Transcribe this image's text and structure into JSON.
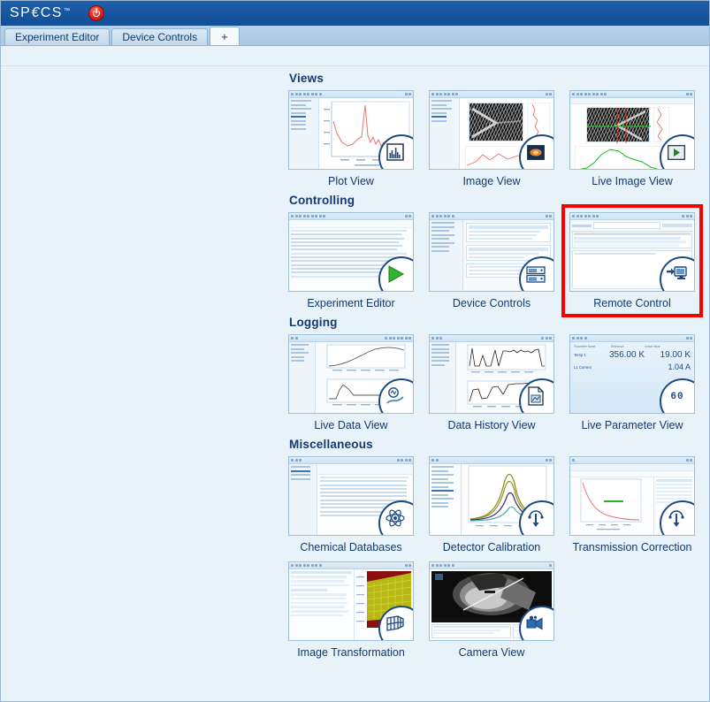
{
  "titlebar": {
    "brand": "SPECS",
    "trademark": "™",
    "power_icon": "power-icon"
  },
  "tabs": [
    {
      "label": "Experiment Editor",
      "active": false
    },
    {
      "label": "Device Controls",
      "active": false
    },
    {
      "label": "+",
      "active": true
    }
  ],
  "highlight": {
    "color": "#fc0000",
    "target": "Remote Control"
  },
  "sections": [
    {
      "title": "Views",
      "cards": [
        {
          "label": "Plot View",
          "icon": "plot-view-icon",
          "highlighted": false
        },
        {
          "label": "Image View",
          "icon": "image-view-icon",
          "highlighted": false
        },
        {
          "label": "Live Image View",
          "icon": "live-image-view-icon",
          "highlighted": false
        }
      ]
    },
    {
      "title": "Controlling",
      "cards": [
        {
          "label": "Experiment Editor",
          "icon": "play-icon",
          "highlighted": false
        },
        {
          "label": "Device Controls",
          "icon": "rack-icon",
          "highlighted": false
        },
        {
          "label": "Remote Control",
          "icon": "remote-control-icon",
          "highlighted": true
        }
      ]
    },
    {
      "title": "Logging",
      "cards": [
        {
          "label": "Live Data View",
          "icon": "live-data-icon",
          "highlighted": false
        },
        {
          "label": "Data History View",
          "icon": "document-chart-icon",
          "highlighted": false
        },
        {
          "label": "Live Parameter View",
          "icon": "sixty-icon",
          "highlighted": false
        }
      ]
    },
    {
      "title": "Miscellaneous",
      "cards": [
        {
          "label": "Chemical Databases",
          "icon": "atom-icon",
          "highlighted": false
        },
        {
          "label": "Detector Calibration",
          "icon": "detector-icon",
          "highlighted": false
        },
        {
          "label": "Transmission Correction",
          "icon": "detector-icon",
          "highlighted": false
        },
        {
          "label": "Image Transformation",
          "icon": "grid-transform-icon",
          "highlighted": false
        },
        {
          "label": "Camera View",
          "icon": "camera-icon",
          "highlighted": false
        }
      ]
    }
  ],
  "thumbnails": {
    "live_parameter_view": {
      "col_param": "Parameter Name",
      "col_reference": "Reference",
      "col_actual": "Actual Value",
      "rows": [
        {
          "name": "Temp 1",
          "reference": "356.00 K",
          "actual": "19.00 K"
        },
        {
          "name": "L1 Current",
          "reference": "",
          "actual": "1.04 A"
        }
      ],
      "badge_text": "60"
    }
  }
}
